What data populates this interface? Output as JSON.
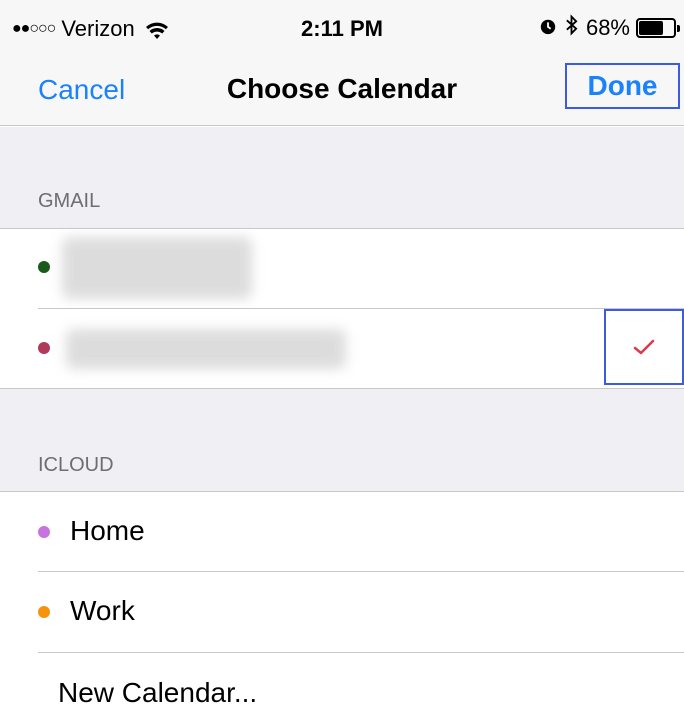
{
  "status_bar": {
    "carrier": "Verizon",
    "signal_dots": "●●○○○",
    "time": "2:11 PM",
    "battery": "68%",
    "battery_level": 0.68
  },
  "nav": {
    "cancel_label": "Cancel",
    "title": "Choose Calendar",
    "done_label": "Done"
  },
  "sections": [
    {
      "header": "GMAIL",
      "items": [
        {
          "color": "#1a5a1a",
          "selected": false
        },
        {
          "color": "#b03a5b",
          "selected": true
        }
      ]
    },
    {
      "header": "ICLOUD",
      "items": [
        {
          "label": "Home",
          "color": "#c774e0"
        },
        {
          "label": "Work",
          "color": "#f7930a"
        }
      ]
    }
  ],
  "new_calendar_label": "New Calendar...",
  "colors": {
    "accent": "#1a82fb",
    "highlight_border": "#3b5be0",
    "check": "#e0384c"
  }
}
